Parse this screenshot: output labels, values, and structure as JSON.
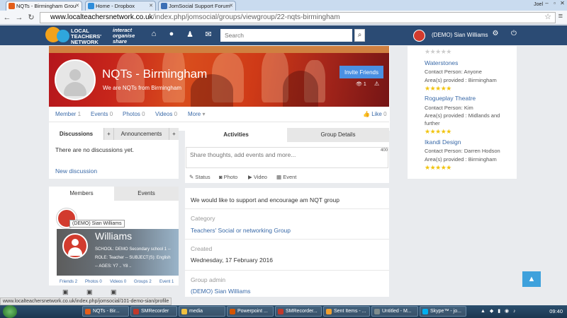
{
  "browser": {
    "tabs": [
      {
        "label": "NQTs - Birmingham Grou",
        "active": true,
        "favicon_color": "#e35e1a"
      },
      {
        "label": "Home - Dropbox",
        "active": false,
        "favicon_color": "#2f8dda"
      },
      {
        "label": "JomSocial Support Forum",
        "active": false,
        "favicon_color": "#3b6fb5"
      }
    ],
    "user": "Joel",
    "url_domain": "www.localteachersnetwork.co.uk",
    "url_path": "/index.php/jomsocial/groups/viewgroup/22-nqts-birmingham",
    "status_url": "www.localteachersnetwork.co.uk/index.php/jomsocial/101-demo-sian/profile"
  },
  "site": {
    "logo_line1": "LOCAL",
    "logo_line2": "TEACHERS'",
    "logo_line3": "NETWORK",
    "tagline1": "interact",
    "tagline2": "organise",
    "tagline3": "share",
    "search_placeholder": "Search",
    "user_name": "(DEMO) Sian Williams",
    "nav_icons": [
      "home-icon",
      "globe-icon",
      "user-icon",
      "mail-icon"
    ]
  },
  "group": {
    "title": "NQTs - Birmingham",
    "subtitle": "We are NQTs from Birmingham",
    "invite_label": "Invite Friends",
    "views": "1",
    "stats": [
      {
        "label": "Member",
        "count": "1"
      },
      {
        "label": "Events",
        "count": "0"
      },
      {
        "label": "Photos",
        "count": "0"
      },
      {
        "label": "Videos",
        "count": "0"
      },
      {
        "label": "More",
        "count": "▾"
      }
    ],
    "like_label": "Like",
    "like_count": "0"
  },
  "discussions": {
    "tab1": "Discussions",
    "tab2": "Announcements",
    "empty_text": "There are no discussions yet.",
    "new_link": "New discussion"
  },
  "members": {
    "tab1": "Members",
    "tab2": "Events",
    "tooltip": "(DEMO) Sian Williams",
    "card": {
      "name": "Williams",
      "line1": "SCHOOL: DEMO Secondary school 1 --",
      "line2": "ROLE: Teacher -- SUBJECT(S): English",
      "line3": "-- AGES: Y7 .. Y8 ..",
      "stats": [
        {
          "label": "Friends",
          "count": "2"
        },
        {
          "label": "Photos",
          "count": "0"
        },
        {
          "label": "Videos",
          "count": "0"
        },
        {
          "label": "Groups",
          "count": "2"
        },
        {
          "label": "Event",
          "count": "1"
        }
      ]
    }
  },
  "activity": {
    "tab1": "Activities",
    "tab2": "Group Details",
    "share_placeholder": "Share thoughts, add events and more...",
    "counter": "400",
    "actions": [
      "Status",
      "Photo",
      "Video",
      "Event"
    ]
  },
  "details": {
    "description": "We would like to support and encourage am NQT group",
    "category_label": "Category",
    "category_value": "Teachers' Social or networking Group",
    "created_label": "Created",
    "created_value": "Wednesday, 17 February 2016",
    "admin_label": "Group admin",
    "admin_value": "(DEMO) Sian Williams"
  },
  "directory": {
    "entries": [
      {
        "name": "Waterstones",
        "contact": "Contact Person: Anyone",
        "area": "Area(s) provided : Birmingham",
        "area2": ""
      },
      {
        "name": "Rogueplay Theatre",
        "contact": "Contact Person: Kim",
        "area": "Area(s) provided : Midlands and",
        "area2": "further"
      },
      {
        "name": "Ikandi Design",
        "contact": "Contact Person: Darren Hodson",
        "area": "Area(s) provided : Birmingham",
        "area2": ""
      }
    ],
    "rating_stars": 5
  },
  "taskbar": {
    "items": [
      {
        "label": "NQTs - Bir...",
        "color": "#e35e1a"
      },
      {
        "label": "SMRecorder",
        "color": "#c0392b"
      },
      {
        "label": "media",
        "color": "#f0c040"
      },
      {
        "label": "Powerpoint ...",
        "color": "#d35400"
      },
      {
        "label": "SMRecorder...",
        "color": "#c0392b"
      },
      {
        "label": "Sent Items - ...",
        "color": "#f0a030"
      },
      {
        "label": "Untitled - M...",
        "color": "#7f8c8d"
      },
      {
        "label": "Skype™ - jo...",
        "color": "#00aff0"
      }
    ],
    "clock": "09:40"
  }
}
